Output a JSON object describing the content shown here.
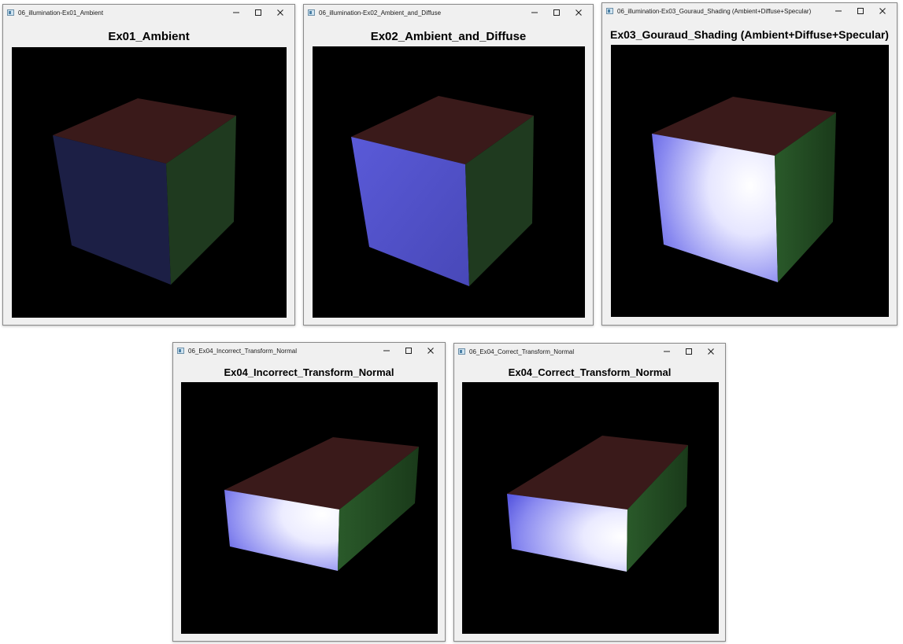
{
  "windows": [
    {
      "title": "06_illumination-Ex01_Ambient",
      "heading": "Ex01_Ambient",
      "render": "ambient-cube"
    },
    {
      "title": "06_illumination-Ex02_Ambient_and_Diffuse",
      "heading": "Ex02_Ambient_and_Diffuse",
      "render": "diffuse-cube"
    },
    {
      "title": "06_illumination-Ex03_Gouraud_Shading (Ambient+Diffuse+Specular)",
      "heading": "Ex03_Gouraud_Shading (Ambient+Diffuse+Specular)",
      "render": "gouraud-cube"
    },
    {
      "title": "06_Ex04_Incorrect_Transform_Normal",
      "heading": "Ex04_Incorrect_Transform_Normal",
      "render": "scaled-box-incorrect-normals"
    },
    {
      "title": "06_Ex04_Correct_Transform_Normal",
      "heading": "Ex04_Correct_Transform_Normal",
      "render": "scaled-box-correct-normals"
    }
  ],
  "window_controls": [
    "minimize-icon",
    "maximize-icon",
    "close-icon"
  ],
  "colors": {
    "background": "#000000",
    "window_chrome": "#f0f0f0",
    "top_face": "#3a1a1a",
    "side_face": "#1f3a1f",
    "ambient_front": "#1c1f45",
    "diffuse_front": "#5656d0",
    "specular_highlight": "#ffffff"
  }
}
